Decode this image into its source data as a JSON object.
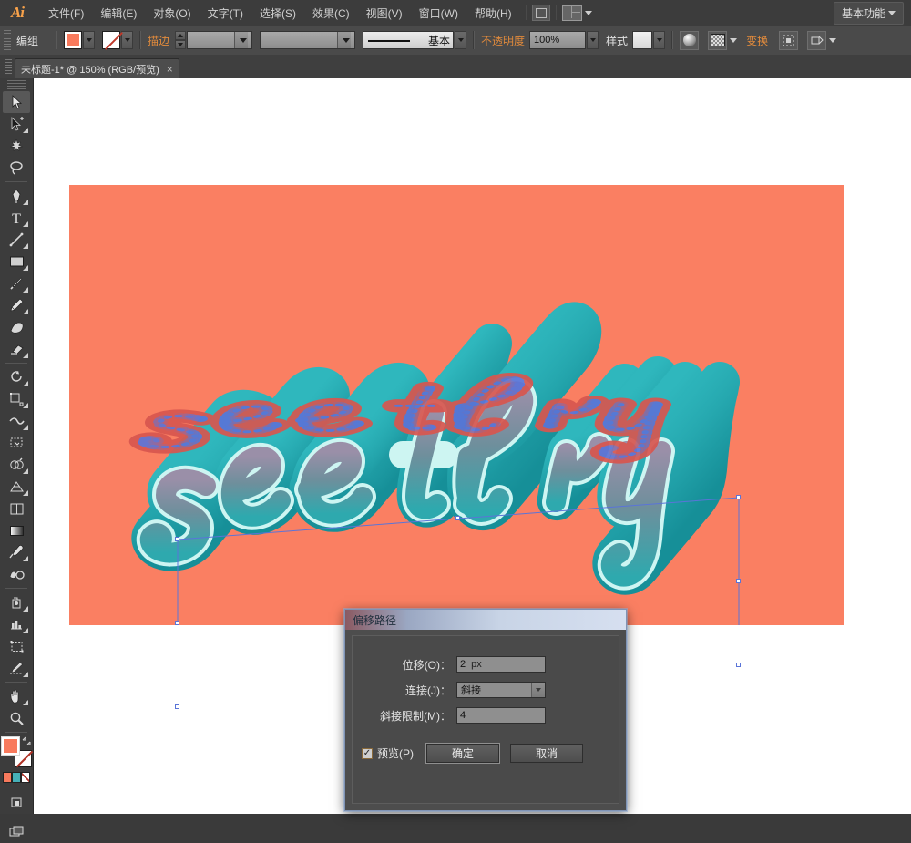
{
  "app": {
    "logo": "Ai",
    "workspace": "基本功能"
  },
  "menubar": {
    "items": [
      {
        "label": "文件(F)",
        "name": "menu-file"
      },
      {
        "label": "编辑(E)",
        "name": "menu-edit"
      },
      {
        "label": "对象(O)",
        "name": "menu-object"
      },
      {
        "label": "文字(T)",
        "name": "menu-type"
      },
      {
        "label": "选择(S)",
        "name": "menu-select"
      },
      {
        "label": "效果(C)",
        "name": "menu-effect"
      },
      {
        "label": "视图(V)",
        "name": "menu-view"
      },
      {
        "label": "窗口(W)",
        "name": "menu-window"
      },
      {
        "label": "帮助(H)",
        "name": "menu-help"
      }
    ],
    "bridge_icon": "bridge-icon",
    "arrange_icon": "arrange-documents-icon"
  },
  "controlbar": {
    "selection_label": "编组",
    "fill_color": "#f87a5d",
    "stroke_label": "描边",
    "stroke_weight": "",
    "stroke_profile": "",
    "brush_label": "基本",
    "opacity_label": "不透明度",
    "opacity_value": "100%",
    "style_label": "样式",
    "transform_label": "变换",
    "icons": [
      "sphere-icon",
      "opacity-mask-icon",
      "align-icon",
      "transform-panel-icon"
    ]
  },
  "tabbar": {
    "tab_title": "未标题-1* @ 150% (RGB/预览)",
    "close_glyph": "×"
  },
  "toolbar": {
    "tools": [
      {
        "name": "selection-tool",
        "selected": true
      },
      {
        "name": "direct-selection-tool",
        "selected": false
      },
      {
        "name": "magic-wand-tool",
        "selected": false
      },
      {
        "name": "lasso-tool",
        "selected": false
      },
      {
        "name": "pen-tool",
        "selected": false
      },
      {
        "name": "type-tool",
        "selected": false
      },
      {
        "name": "line-segment-tool",
        "selected": false
      },
      {
        "name": "rectangle-tool",
        "selected": false
      },
      {
        "name": "paintbrush-tool",
        "selected": false
      },
      {
        "name": "pencil-tool",
        "selected": false
      },
      {
        "name": "blob-brush-tool",
        "selected": false
      },
      {
        "name": "eraser-tool",
        "selected": false
      },
      {
        "name": "rotate-tool",
        "selected": false
      },
      {
        "name": "scale-tool",
        "selected": false
      },
      {
        "name": "width-tool",
        "selected": false
      },
      {
        "name": "free-transform-tool",
        "selected": false
      },
      {
        "name": "shape-builder-tool",
        "selected": false
      },
      {
        "name": "perspective-grid-tool",
        "selected": false
      },
      {
        "name": "mesh-tool",
        "selected": false
      },
      {
        "name": "gradient-tool",
        "selected": false
      },
      {
        "name": "eyedropper-tool",
        "selected": false
      },
      {
        "name": "blend-tool",
        "selected": false
      },
      {
        "name": "symbol-sprayer-tool",
        "selected": false
      },
      {
        "name": "column-graph-tool",
        "selected": false
      },
      {
        "name": "artboard-tool",
        "selected": false
      },
      {
        "name": "slice-tool",
        "selected": false
      },
      {
        "name": "hand-tool",
        "selected": false
      },
      {
        "name": "zoom-tool",
        "selected": false
      }
    ],
    "fill_color": "#f87a5d",
    "stroke_color": "none",
    "color_modes": [
      "#f87a5d",
      "#46b0b8",
      "#ffffff"
    ]
  },
  "artwork": {
    "background_color": "#fa7f62",
    "text": "see thru",
    "extrude_color": "#1f9ba4",
    "highlight_color": "#cdf5f2",
    "shadow_color": "#8a7f96",
    "anchor_color": "#5a74d8"
  },
  "dialog": {
    "title": "偏移路径",
    "fields": [
      {
        "label": "位移(O)：",
        "value": "2",
        "unit": "px",
        "type": "text",
        "name": "offset-field"
      },
      {
        "label": "连接(J)：",
        "value": "斜接",
        "unit": "",
        "type": "select",
        "name": "join-select"
      },
      {
        "label": "斜接限制(M)：",
        "value": "4",
        "unit": "",
        "type": "text",
        "name": "miter-limit-field"
      }
    ],
    "preview_label": "预览(P)",
    "preview_checked": true,
    "check_glyph": "✓",
    "ok_label": "确定",
    "cancel_label": "取消"
  }
}
